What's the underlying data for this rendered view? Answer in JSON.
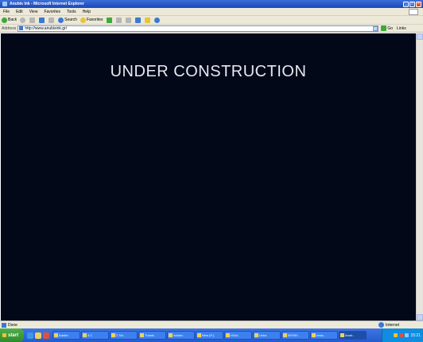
{
  "window": {
    "title": "Anubis Ink - Microsoft Internet Explorer"
  },
  "menubar": {
    "items": [
      "File",
      "Edit",
      "View",
      "Favorites",
      "Tools",
      "Help"
    ]
  },
  "toolbar": {
    "back_label": "Back",
    "search_label": "Search",
    "favorites_label": "Favorites"
  },
  "addressbar": {
    "label": "Address",
    "url": "http://www.anubisink.gr/",
    "go_label": "Go",
    "links_label": "Links"
  },
  "page": {
    "headline": "UNDER CONSTRUCTION",
    "background_color": "#020818",
    "text_color": "#e6e8f0"
  },
  "statusbar": {
    "status": "Done",
    "zone": "Internet"
  },
  "taskbar": {
    "start_label": "start",
    "tasks": [
      "Adobe",
      "4 C",
      "2 Tot..",
      "Transf..",
      "Adobe..",
      "New (F:)",
      "HOcl..",
      "Links",
      "WYSH..",
      "ness..",
      "Wi-Fi..",
      "Desk..",
      "Anub.."
    ],
    "clock": "15:21"
  },
  "colors": {
    "titlebar": "#1c47b8",
    "taskbar": "#245cd0",
    "start": "#2f8a2c",
    "chrome": "#ece9d8"
  }
}
